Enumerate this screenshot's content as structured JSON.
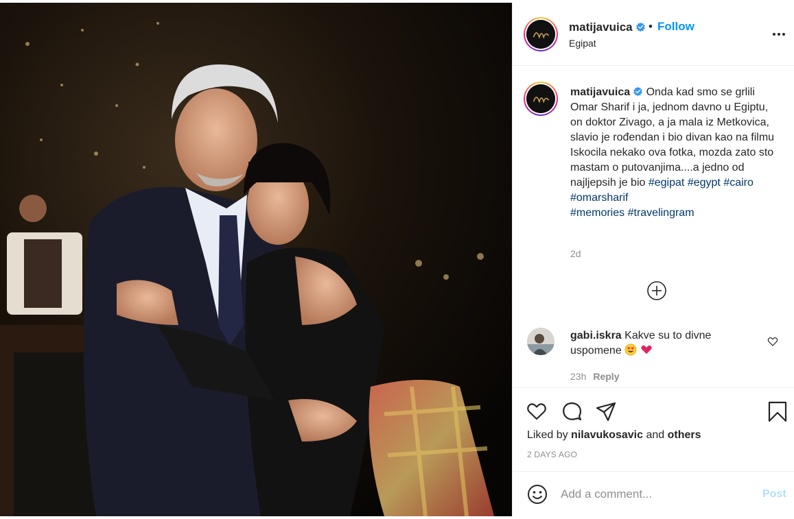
{
  "post": {
    "username": "matijavuica",
    "dot": "•",
    "follow_label": "Follow",
    "location": "Egipat"
  },
  "caption": {
    "username": "matijavuica",
    "text": "Onda kad smo se grlili Omar Sharif i ja, jednom davno u Egiptu, on doktor Zivago, a ja mala iz Metkovica, slavio je rođendan i bio divan kao na filmu\nIskocila nekako ova fotka, mozda zato sto mastam o putovanjima....a jedno od najljepsih je bio ",
    "hashtags": [
      "#egipat",
      "#egypt",
      "#cairo",
      "#omarsharif",
      "#memories",
      "#travelingram"
    ],
    "time": "2d"
  },
  "comment": {
    "username": "gabi.iskra",
    "text": "Kakve su to divne uspomene",
    "time": "23h",
    "reply_label": "Reply"
  },
  "likes": {
    "prefix": "Liked by",
    "user": "nilavukosavic",
    "conjunction": "and",
    "others": "others"
  },
  "date": "2 DAYS AGO",
  "add_comment": {
    "placeholder": "Add a comment...",
    "post_label": "Post"
  },
  "colors": {
    "link_blue": "#0095f6",
    "hashtag": "#00376b",
    "muted": "#8e8e8e",
    "post_disabled": "#b2dffc"
  },
  "icons": {
    "header": [
      "avatar-logo",
      "verified-badge-icon",
      "more-options-icon"
    ],
    "actions": [
      "heart-icon",
      "comment-icon",
      "share-icon",
      "bookmark-icon"
    ],
    "misc": [
      "load-more-icon",
      "emoji-icon",
      "heart-eyes-emoji",
      "red-heart-emoji"
    ]
  }
}
